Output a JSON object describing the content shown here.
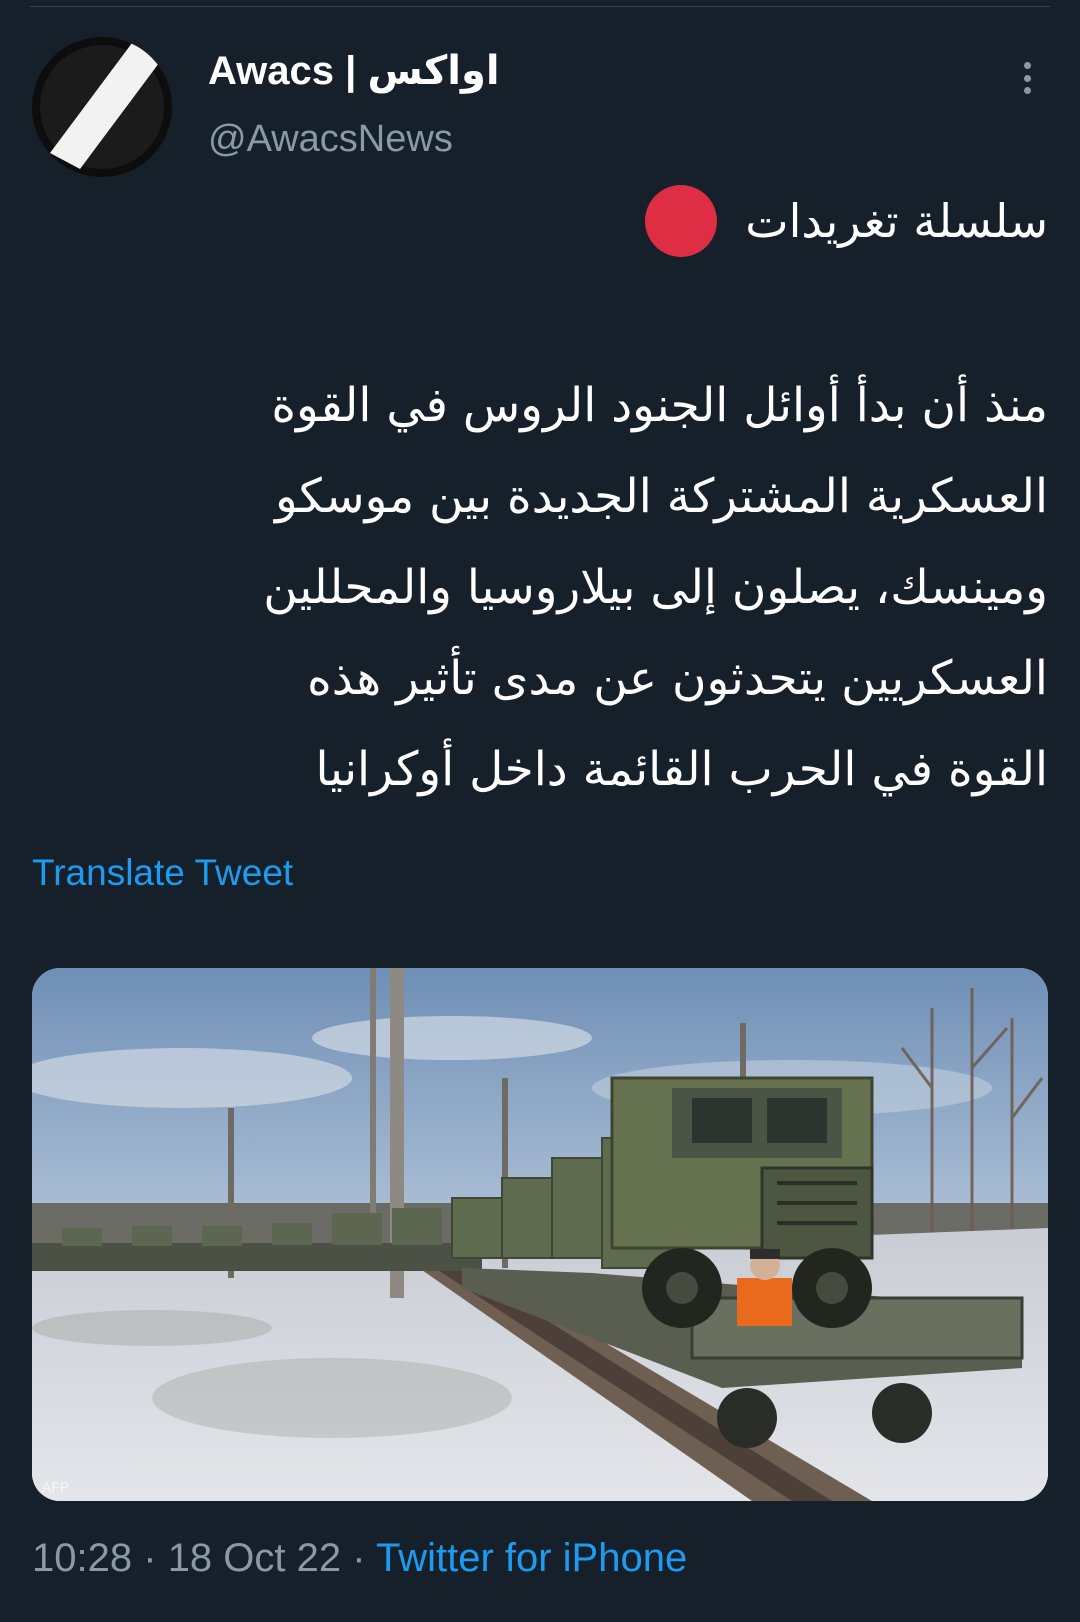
{
  "tweet": {
    "author_name": "Awacs | اواكس",
    "author_handle": "@AwacsNews",
    "thread_label": "سلسلة تغريدات",
    "thread_marker_color": "#dd2e44",
    "body_lines": [
      "منذ أن بدأ أوائل الجنود الروس في القوة",
      "العسكرية المشتركة الجديدة بين موسكو",
      "ومينسك، يصلون إلى بيلاروسيا والمحللين",
      "العسكريين يتحدثون عن مدى تأثير هذه",
      "القوة في الحرب القائمة داخل أوكرانيا"
    ],
    "translate_label": "Translate Tweet",
    "time": "10:28",
    "date": "18 Oct 22",
    "separator": "·",
    "source": "Twitter for iPhone"
  },
  "media": {
    "image_description_icon": "photo-military-train",
    "watermark": "AFP"
  },
  "colors": {
    "background": "#15202b",
    "text": "#ffffff",
    "secondary": "#8b98a5",
    "link": "#1d9bf0"
  },
  "icons": {
    "more": "more-vertical-icon",
    "thread": "red-circle-icon"
  }
}
